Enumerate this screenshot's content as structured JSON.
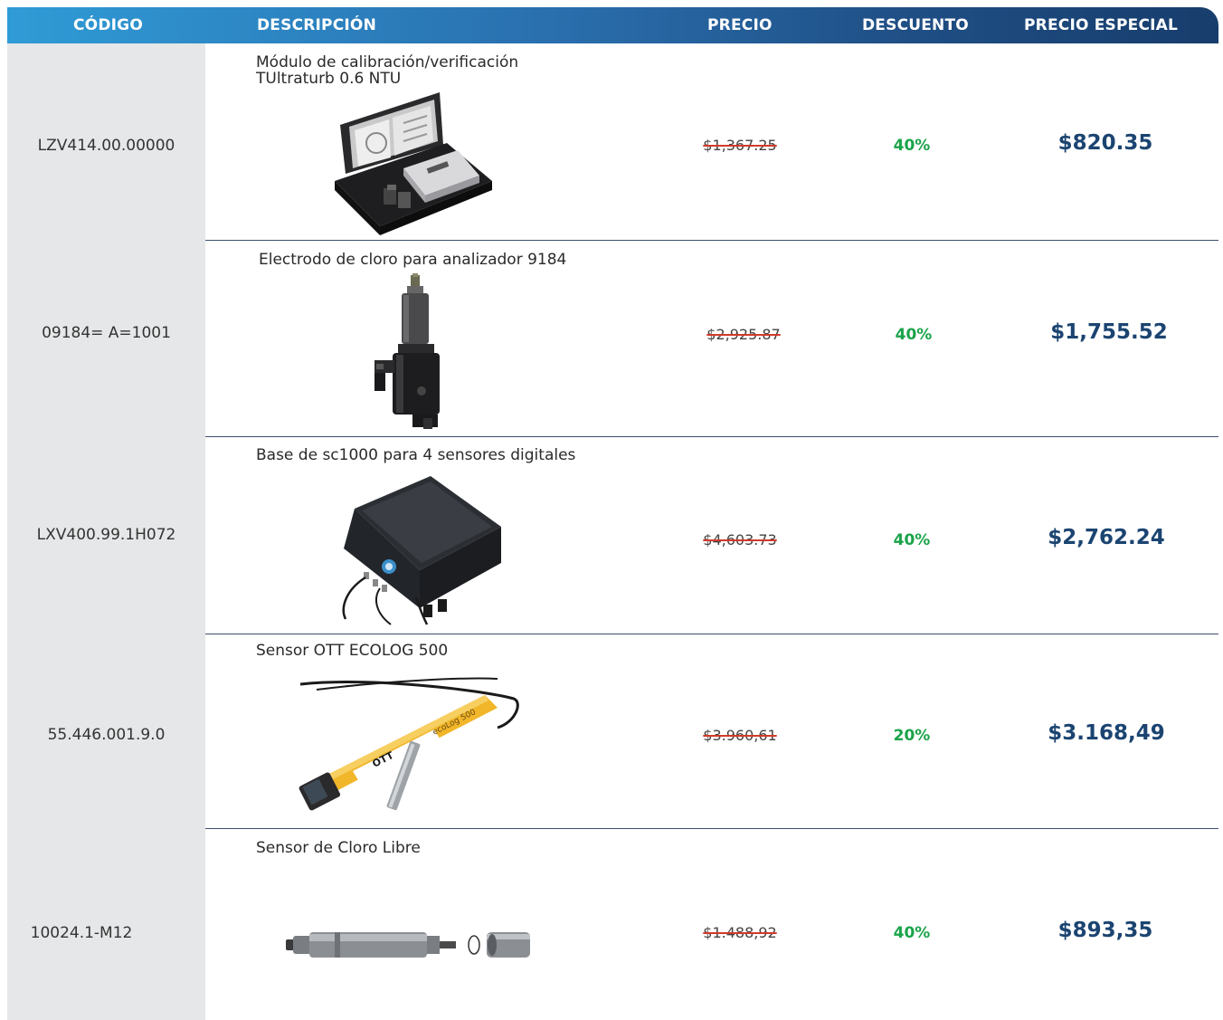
{
  "header": {
    "codigo": "CÓDIGO",
    "descripcion": "DESCRIPCIÓN",
    "precio": "PRECIO",
    "descuento": "DESCUENTO",
    "precio_especial": "PRECIO ESPECIAL"
  },
  "rows": [
    {
      "code": "LZV414.00.00000",
      "desc1": "Módulo de calibración/verificación",
      "desc2": "TUltraturb 0.6 NTU",
      "price": "$1,367.25",
      "discount": "40%",
      "special": "$820.35"
    },
    {
      "code": "09184= A=1001",
      "desc1": "Electrodo de cloro para analizador 9184",
      "price": "$2,925.87",
      "discount": "40%",
      "special": "$1,755.52"
    },
    {
      "code": "LXV400.99.1H072",
      "desc1": "Base de sc1000 para 4 sensores digitales",
      "price": "$4,603.73",
      "discount": "40%",
      "special": "$2,762.24"
    },
    {
      "code": "55.446.001.9.0",
      "desc1": "Sensor OTT ECOLOG 500",
      "price": "$3.960,61",
      "discount": "20%",
      "special": "$3.168,49"
    },
    {
      "code": "10024.1-M12",
      "desc1": "Sensor de Cloro Libre",
      "price": "$1.488,92",
      "discount": "40%",
      "special": "$893,35"
    }
  ],
  "product_labels": {
    "ott_logo": "OTT",
    "ecolog_text": "ecoLog 500"
  }
}
